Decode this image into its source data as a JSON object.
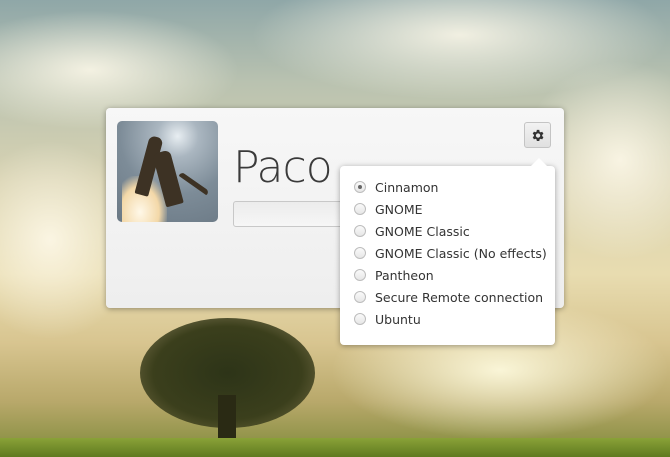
{
  "user": {
    "name": "Paco",
    "password_value": ""
  },
  "session_menu": {
    "icon": "gear-icon",
    "selected": "Cinnamon",
    "items": [
      {
        "label": "Cinnamon",
        "selected": true
      },
      {
        "label": "GNOME",
        "selected": false
      },
      {
        "label": "GNOME Classic",
        "selected": false
      },
      {
        "label": "GNOME Classic (No effects)",
        "selected": false
      },
      {
        "label": "Pantheon",
        "selected": false
      },
      {
        "label": "Secure Remote connection",
        "selected": false
      },
      {
        "label": "Ubuntu",
        "selected": false
      }
    ]
  }
}
